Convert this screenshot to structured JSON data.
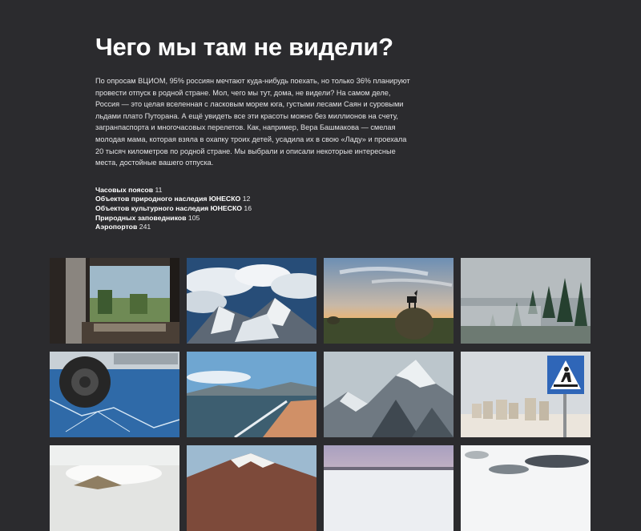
{
  "article": {
    "title": "Чего мы там не видели?",
    "intro": "По опросам ВЦИОМ, 95% россиян мечтают куда-нибудь поехать, но только 36% планируют провести отпуск в родной стране. Мол, чего мы тут, дома, не видели? На самом деле, Россия — это целая вселенная с ласковым морем юга, густыми лесами Саян и суровыми льдами плато Путорана. А ещё увидеть все эти красоты можно без миллионов на счету, загранпаспорта и многочасовых перелетов. Как, например, Вера Башмакова — смелая молодая мама, которая взяла в охапку троих детей, усадила их в свою «Ладу» и проехала 20 тысяч километров по родной стране. Мы выбрали и описали некоторые интересные места, достойные вашего отпуска."
  },
  "stats": [
    {
      "label": "Часовых поясов",
      "value": "11"
    },
    {
      "label": "Объектов природного наследия ЮНЕСКО",
      "value": "12"
    },
    {
      "label": "Объектов культурного наследия ЮНЕСКО",
      "value": "16"
    },
    {
      "label": "Природных заповедников",
      "value": "105"
    },
    {
      "label": "Аэропортов",
      "value": "241"
    }
  ],
  "gallery": [
    {
      "subject": "train-window"
    },
    {
      "subject": "mountains-above-clouds"
    },
    {
      "subject": "wolf-on-haystack-sunset"
    },
    {
      "subject": "foggy-forest"
    },
    {
      "subject": "car-wheel-on-ice"
    },
    {
      "subject": "lake-shore"
    },
    {
      "subject": "snowy-peaks"
    },
    {
      "subject": "pedestrian-sign-snow"
    },
    {
      "subject": "misty-valley"
    },
    {
      "subject": "volcano"
    },
    {
      "subject": "frozen-plain"
    },
    {
      "subject": "snowy-clouds"
    }
  ]
}
